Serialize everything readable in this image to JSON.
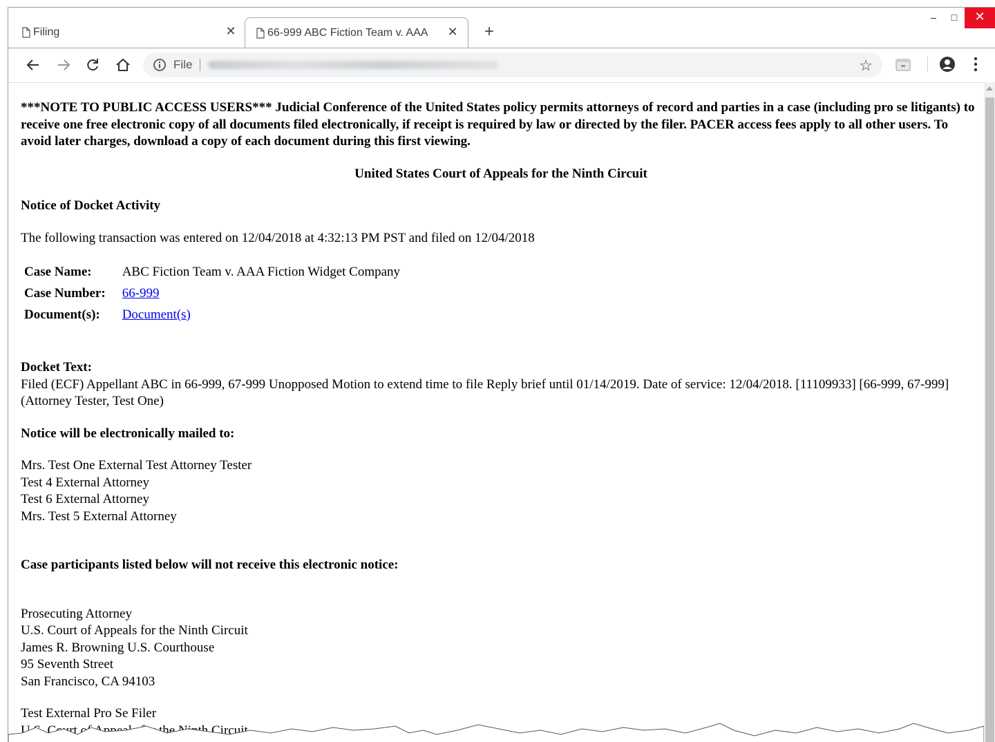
{
  "browser": {
    "tabs": [
      {
        "title": "Filing",
        "active": false
      },
      {
        "title": "66-999 ABC Fiction Team v. AAA",
        "active": true
      }
    ],
    "address_bar": {
      "security_label": "File"
    },
    "window_controls": {
      "minimize": "–",
      "maximize": "□",
      "close": "✕"
    }
  },
  "page": {
    "public_notice": "***NOTE TO PUBLIC ACCESS USERS*** Judicial Conference of the United States policy permits attorneys of record and parties in a case (including pro se litigants) to receive one free electronic copy of all documents filed electronically, if receipt is required by law or directed by the filer. PACER access fees apply to all other users. To avoid later charges, download a copy of each document during this first viewing.",
    "court_name": "United States Court of Appeals for the Ninth Circuit",
    "notice_title": "Notice of Docket Activity",
    "transaction_line": "The following transaction was entered on 12/04/2018 at 4:32:13 PM PST and filed on 12/04/2018",
    "case_info": {
      "case_name_label": "Case Name:",
      "case_name": "ABC Fiction Team v. AAA Fiction Widget Company",
      "case_number_label": "Case Number:",
      "case_number": "66-999",
      "documents_label": "Document(s):",
      "documents_link": "Document(s)"
    },
    "docket_text_label": "Docket Text:",
    "docket_text": "Filed (ECF) Appellant ABC in 66-999, 67-999 Unopposed Motion to extend time to file Reply brief until 01/14/2019. Date of service: 12/04/2018. [11109933] [66-999, 67-999] (Attorney Tester, Test One)",
    "mailed_heading": "Notice will be electronically mailed to:",
    "mailed_recipients": [
      "Mrs. Test One External Test Attorney Tester",
      "Test 4 External Attorney",
      "Test 6 External Attorney",
      "Mrs. Test 5 External Attorney"
    ],
    "not_receive_heading": "Case participants listed below will not receive this electronic notice:",
    "participant_address": [
      "Prosecuting Attorney",
      "U.S. Court of Appeals for the Ninth Circuit",
      "James R. Browning U.S. Courthouse",
      "95 Seventh Street",
      "San Francisco, CA 94103"
    ],
    "second_participant": [
      "Test External Pro Se Filer",
      "U.S. Court of Appeals for the Ninth Circuit"
    ]
  },
  "colors": {
    "link": "#0000ee",
    "close_button": "#e81123"
  }
}
